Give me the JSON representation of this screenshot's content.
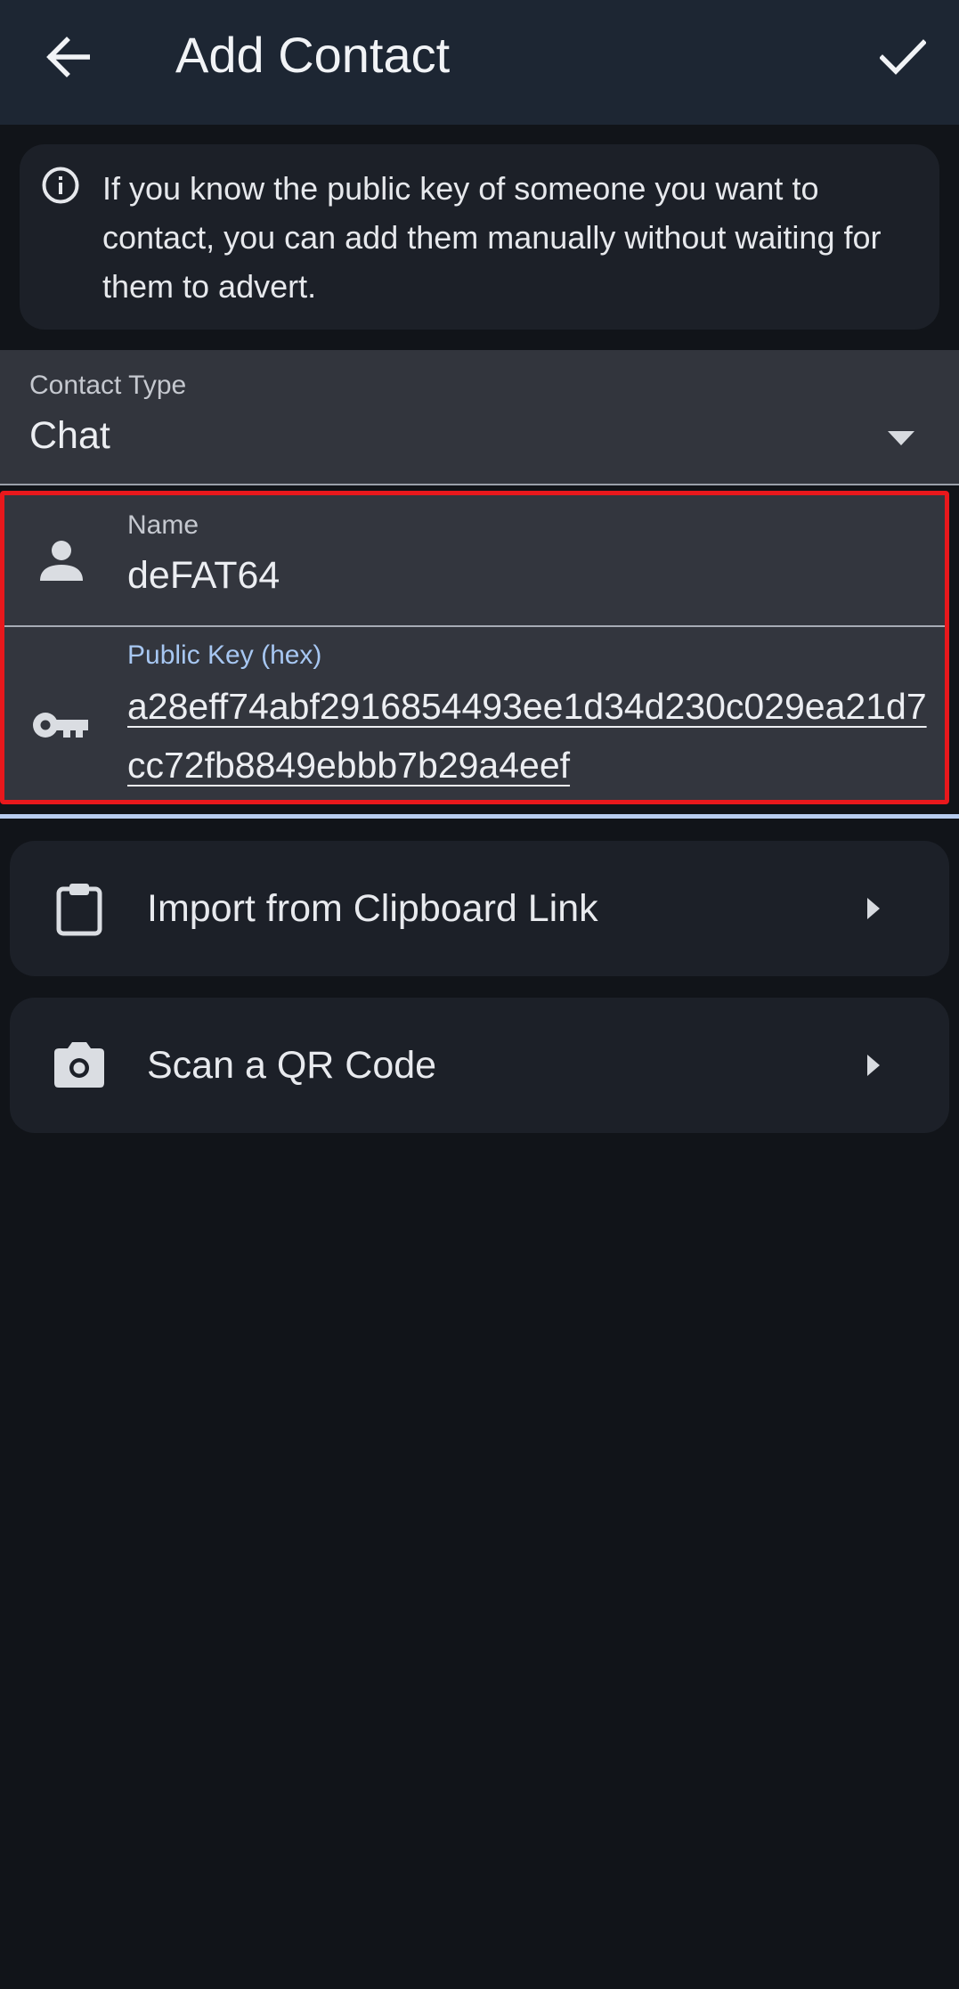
{
  "app_bar": {
    "title": "Add Contact",
    "back_icon": "arrow-left-icon",
    "confirm_icon": "check-icon"
  },
  "info_card": {
    "icon": "info-icon",
    "text": "If you know the public key of someone you want to contact, you can add them manually without waiting for them to advert."
  },
  "contact_type": {
    "label": "Contact Type",
    "value": "Chat",
    "icon": "dropdown-arrow-icon"
  },
  "name_field": {
    "icon": "person-icon",
    "label": "Name",
    "value": "deFAT64"
  },
  "public_key_field": {
    "icon": "key-icon",
    "label": "Public Key (hex)",
    "value": "a28eff74abf2916854493ee1d34d230c029ea21d7cc72fb8849ebbb7b29a4eef"
  },
  "actions": [
    {
      "label": "Import from Clipboard Link",
      "icon": "clipboard-icon",
      "chevron": "chevron-right-icon"
    },
    {
      "label": "Scan a QR Code",
      "icon": "camera-icon",
      "chevron": "chevron-right-icon"
    }
  ],
  "colors": {
    "background": "#111419",
    "app_bar": "#1d2633",
    "card": "#1c2028",
    "field": "#32353d",
    "highlight": "#e8181c",
    "accent_label": "#a7c7f2"
  }
}
